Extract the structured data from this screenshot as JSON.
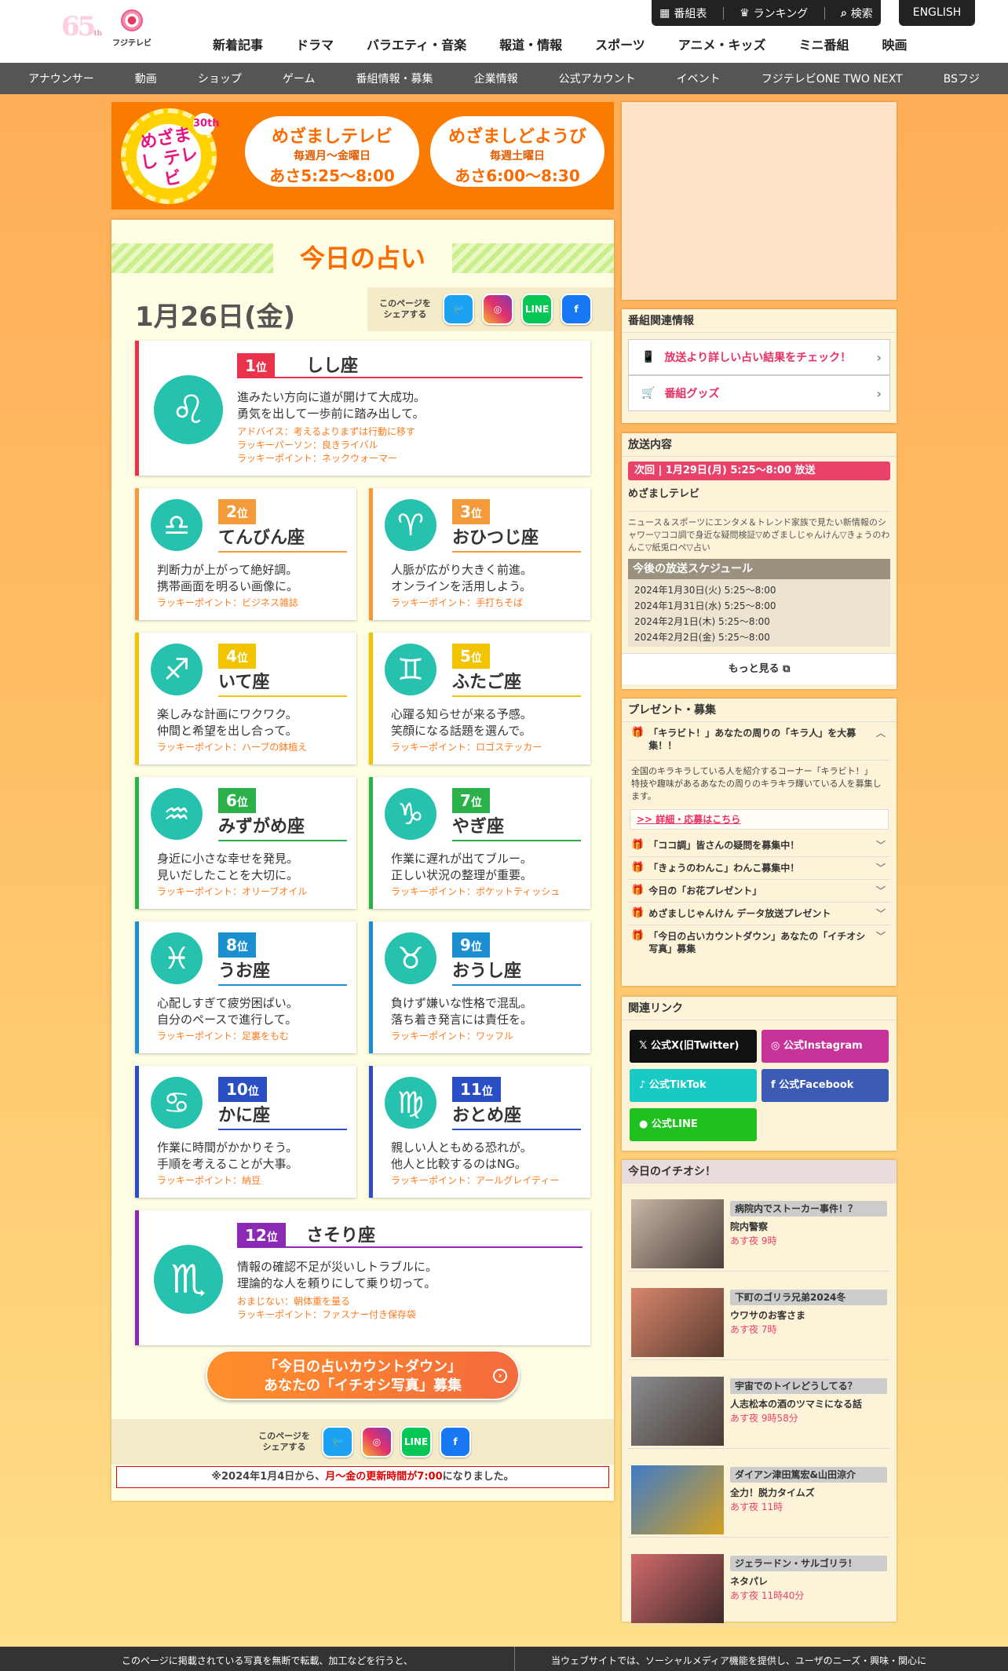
{
  "header": {
    "logo_65": "65",
    "logo_th": "th",
    "fuji_logo_text": "フジテレビ",
    "top_buttons": [
      "番組表",
      "ランキング",
      "検索"
    ],
    "english": "ENGLISH",
    "main_nav": [
      "新着記事",
      "ドラマ",
      "バラエティ・音楽",
      "報道・情報",
      "スポーツ",
      "アニメ・キッズ",
      "ミニ番組",
      "映画"
    ],
    "sub_nav": [
      "アナウンサー",
      "動画",
      "ショップ",
      "ゲーム",
      "番組情報・募集",
      "企業情報",
      "公式アカウント",
      "イベント",
      "フジテレビONE TWO NEXT",
      "BSフジ"
    ]
  },
  "banner": {
    "logo_text": "めざまし テレビ",
    "logo_30": "30th",
    "weekday_title": "めざましテレビ",
    "weekday_days": "毎週月〜金曜日",
    "weekday_time": "あさ5:25〜8:00",
    "sat_title": "めざましどようび",
    "sat_days": "毎週土曜日",
    "sat_time": "あさ6:00〜8:30"
  },
  "page": {
    "title": "今日の占い",
    "date": "1月26日(金)",
    "share_label": "このページを シェアする",
    "sns": [
      "Twitter",
      "Instagram",
      "LINE",
      "Facebook"
    ],
    "cta_line1": "「今日の占いカウントダウン」",
    "cta_line2": "あなたの「イチオシ写真」募集",
    "notice_prefix": "※2024年1月4日から、",
    "notice_em": "月〜金の更新時間が7:00",
    "notice_suffix": "になりました。"
  },
  "ranks": [
    {
      "rank": "1",
      "unit": "位",
      "sign": "しし座",
      "symbol": "♌",
      "color": "#e8334a",
      "desc1": "進みたい方向に道が開けて大成功。",
      "desc2": "勇気を出して一歩前に踏み出して。",
      "extra1": "アドバイス：考えるよりまずは行動に移す",
      "extra2": "ラッキーパーソン：良きライバル",
      "lucky": "ラッキーポイント：ネックウォーマー"
    },
    {
      "rank": "2",
      "unit": "位",
      "sign": "てんびん座",
      "symbol": "♎",
      "color": "#f39a3a",
      "desc1": "判断力が上がって絶好調。",
      "desc2": "携帯画面を明るい画像に。",
      "lucky": "ラッキーポイント：ビジネス雑誌"
    },
    {
      "rank": "3",
      "unit": "位",
      "sign": "おひつじ座",
      "symbol": "♈",
      "color": "#f39a3a",
      "desc1": "人脈が広がり大きく前進。",
      "desc2": "オンラインを活用しよう。",
      "lucky": "ラッキーポイント：手打ちそば"
    },
    {
      "rank": "4",
      "unit": "位",
      "sign": "いて座",
      "symbol": "♐",
      "color": "#f2c400",
      "desc1": "楽しみな計画にワクワク。",
      "desc2": "仲間と希望を出し合って。",
      "lucky": "ラッキーポイント：ハーブの鉢植え"
    },
    {
      "rank": "5",
      "unit": "位",
      "sign": "ふたご座",
      "symbol": "♊",
      "color": "#f2c400",
      "desc1": "心躍る知らせが来る予感。",
      "desc2": "笑顔になる話題を選んで。",
      "lucky": "ラッキーポイント：ロゴステッカー"
    },
    {
      "rank": "6",
      "unit": "位",
      "sign": "みずがめ座",
      "symbol": "♒",
      "color": "#2ab14a",
      "desc1": "身近に小さな幸せを発見。",
      "desc2": "見いだしたことを大切に。",
      "lucky": "ラッキーポイント：オリーブオイル"
    },
    {
      "rank": "7",
      "unit": "位",
      "sign": "やぎ座",
      "symbol": "♑",
      "color": "#2ab14a",
      "desc1": "作業に遅れが出てブルー。",
      "desc2": "正しい状況の整理が重要。",
      "lucky": "ラッキーポイント：ポケットティッシュ"
    },
    {
      "rank": "8",
      "unit": "位",
      "sign": "うお座",
      "symbol": "♓",
      "color": "#1b8fd0",
      "desc1": "心配しすぎて疲労困ぱい。",
      "desc2": "自分のペースで進行して。",
      "lucky": "ラッキーポイント：足裏をもむ"
    },
    {
      "rank": "9",
      "unit": "位",
      "sign": "おうし座",
      "symbol": "♉",
      "color": "#1b8fd0",
      "desc1": "負けず嫌いな性格で混乱。",
      "desc2": "落ち着き発言には責任を。",
      "lucky": "ラッキーポイント：ワッフル"
    },
    {
      "rank": "10",
      "unit": "位",
      "sign": "かに座",
      "symbol": "♋",
      "color": "#2a4fc4",
      "desc1": "作業に時間がかかりそう。",
      "desc2": "手順を考えることが大事。",
      "lucky": "ラッキーポイント：納豆"
    },
    {
      "rank": "11",
      "unit": "位",
      "sign": "おとめ座",
      "symbol": "♍",
      "color": "#2a4fc4",
      "desc1": "親しい人ともめる恐れが。",
      "desc2": "他人と比較するのはNG。",
      "lucky": "ラッキーポイント：アールグレイティー"
    },
    {
      "rank": "12",
      "unit": "位",
      "sign": "さそり座",
      "symbol": "♏",
      "color": "#8b2ab4",
      "desc1": "情報の確認不足が災いしトラブルに。",
      "desc2": "理論的な人を頼りにして乗り切って。",
      "extra1": "おまじない：朝体重を量る",
      "lucky": "ラッキーポイント：ファスナー付き保存袋"
    }
  ],
  "sidebar": {
    "related_title": "番組関連情報",
    "related_links": [
      "放送より詳しい占い結果をチェック！",
      "番組グッズ"
    ],
    "broadcast_title": "放送内容",
    "next_bar": "次回 | 1月29日(月) 5:25〜8:00 放送",
    "program_name": "めざましテレビ",
    "program_desc": "ニュース＆スポーツにエンタメ＆トレンド家族で見たい新情報のシャワー▽ココ調で身近な疑問検証▽めざましじゃんけん▽きょうのわんこ▽紙兎ロペ▽占い",
    "schedule_title": "今後の放送スケジュール",
    "schedule": [
      "2024年1月30日(火) 5:25〜8:00",
      "2024年1月31日(水) 5:25〜8:00",
      "2024年2月1日(木) 5:25〜8:00",
      "2024年2月2日(金) 5:25〜8:00"
    ],
    "more": "もっと見る",
    "present_title": "プレゼント・募集",
    "present_open": "「キラビト！」あなたの周りの「キラ人」を大募集！！",
    "present_open_body1": "全国のキラキラしている人を紹介するコーナー「キラビト！」",
    "present_open_body2": "特技や趣味があるあなたの周りのキラキラ輝いている人を募集します。",
    "present_open_link": ">> 詳細・応募はこちら",
    "present_items": [
      "「ココ調」皆さんの疑問を募集中！",
      "「きょうのわんこ」わんこ募集中！",
      "今日の「お花プレゼント」",
      "めざましじゃんけん データ放送プレゼント",
      "「今日の占いカウントダウン」あなたの「イチオシ写真」募集"
    ],
    "links_title": "関連リンク",
    "links": [
      "公式X(旧Twitter)",
      "公式Instagram",
      "公式TikTok",
      "公式Facebook",
      "公式LINE"
    ],
    "pick_title": "今日のイチオシ！",
    "picks": [
      {
        "tag": "病院内でストーカー事件！？",
        "title": "院内警察",
        "time": "あす夜 9時"
      },
      {
        "tag": "下町のゴリラ兄弟2024冬",
        "title": "ウワサのお客さま",
        "time": "あす夜 7時"
      },
      {
        "tag": "宇宙でのトイレどうしてる？",
        "title": "人志松本の酒のツマミになる話",
        "time": "あす夜 9時58分"
      },
      {
        "tag": "ダイアン津田篤宏&山田涼介",
        "title": "全力！脱力タイムズ",
        "time": "あす夜 11時"
      },
      {
        "tag": "ジェラードン・サルゴリラ！",
        "title": "ネタパレ",
        "time": "あす夜 11時40分"
      }
    ]
  },
  "footer": {
    "left": "このページに掲載されている写真を無断で転載、加工などを行うと、",
    "right": "当ウェブサイトでは、ソーシャルメディア機能を提供し、ユーザのニーズ・興味・関心に"
  }
}
